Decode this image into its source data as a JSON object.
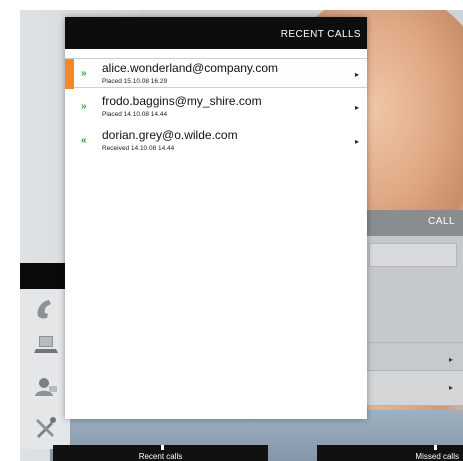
{
  "popup": {
    "title": "RECENT CALLS",
    "items": [
      {
        "name": "alice.wonderland@company.com",
        "meta": "Placed 15.10.08 16.29",
        "direction": "outgoing-call-icon",
        "selected": true
      },
      {
        "name": "frodo.baggins@my_shire.com",
        "meta": "Placed 14.10.08 14.44",
        "direction": "outgoing-call-icon",
        "selected": false
      },
      {
        "name": "dorian.grey@o.wilde.com",
        "meta": "Received 14.10.08 14.44",
        "direction": "incoming-call-icon",
        "selected": false
      }
    ]
  },
  "call_panel": {
    "title": "CALL"
  },
  "bottom_tabs": {
    "recent": "Recent calls",
    "missed": "Missed calls"
  },
  "icons": {
    "outgoing": "»",
    "incoming": "«",
    "chevron": "▸"
  },
  "colors": {
    "accent_orange": "#ef8a25",
    "outgoing_green": "#3fa542",
    "header_black": "#0d0d0d"
  }
}
